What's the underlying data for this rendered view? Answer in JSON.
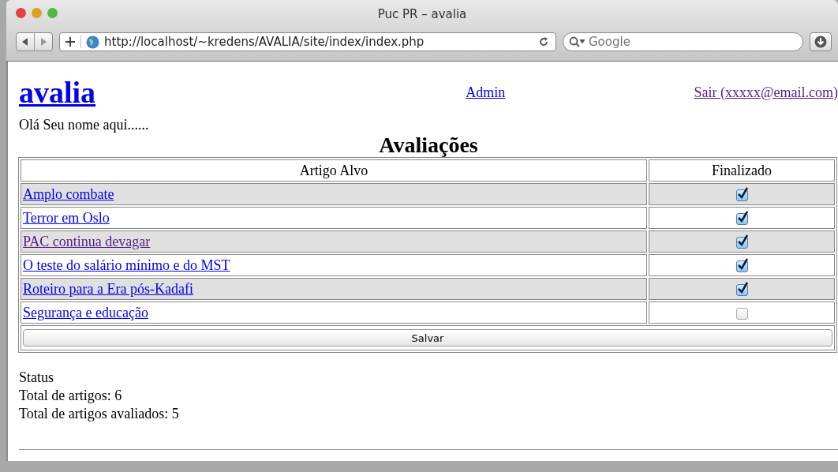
{
  "window": {
    "title": "Puc PR – avalia"
  },
  "toolbar": {
    "url": "http://localhost/~kredens/AVALIA/site/index/index.php",
    "search": {
      "placeholder": "Google"
    }
  },
  "header": {
    "logo": "avalia",
    "admin_link": "Admin",
    "logout_link": {
      "label": "Sair (xxxxx@email.com)",
      "visited": true
    }
  },
  "greeting": "Olá Seu nome aqui......",
  "table": {
    "title": "Avaliações",
    "columns": [
      "Artigo Alvo",
      "Finalizado"
    ],
    "rows": [
      {
        "article": "Amplo combate",
        "visited": false,
        "checked": true
      },
      {
        "article": "Terror em Oslo",
        "visited": false,
        "checked": true
      },
      {
        "article": "PAC continua devagar",
        "visited": true,
        "checked": true
      },
      {
        "article": "O teste do salário mínimo e do MST",
        "visited": false,
        "checked": true
      },
      {
        "article": "Roteiro para a Era pós-Kadafi",
        "visited": false,
        "checked": true
      },
      {
        "article": "Segurança e educação",
        "visited": false,
        "checked": false
      }
    ],
    "button": "Salvar"
  },
  "status": {
    "title": "Status",
    "lines": [
      "Total de artigos: 6",
      "Total de artigos avaliados: 5"
    ]
  }
}
